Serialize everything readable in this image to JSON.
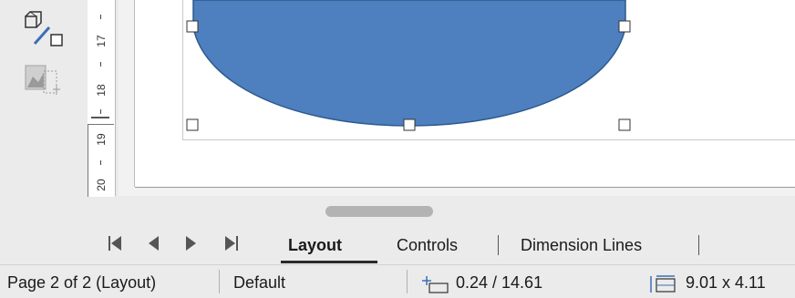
{
  "ruler": {
    "marks": [
      "17",
      "18",
      "19",
      "20"
    ]
  },
  "tabs": {
    "items": [
      {
        "label": "Layout",
        "active": true
      },
      {
        "label": "Controls",
        "active": false
      },
      {
        "label": "Dimension Lines",
        "active": false
      }
    ]
  },
  "status": {
    "page": "Page 2 of 2 (Layout)",
    "style": "Default",
    "position_icon": "position-icon",
    "position": "0.24 / 14.61",
    "size_icon": "size-icon",
    "size": "9.01 x 4.11"
  },
  "colors": {
    "shape_fill": "#4e7fbf",
    "shape_stroke": "#2d5a8c",
    "background": "#ebebeb"
  }
}
